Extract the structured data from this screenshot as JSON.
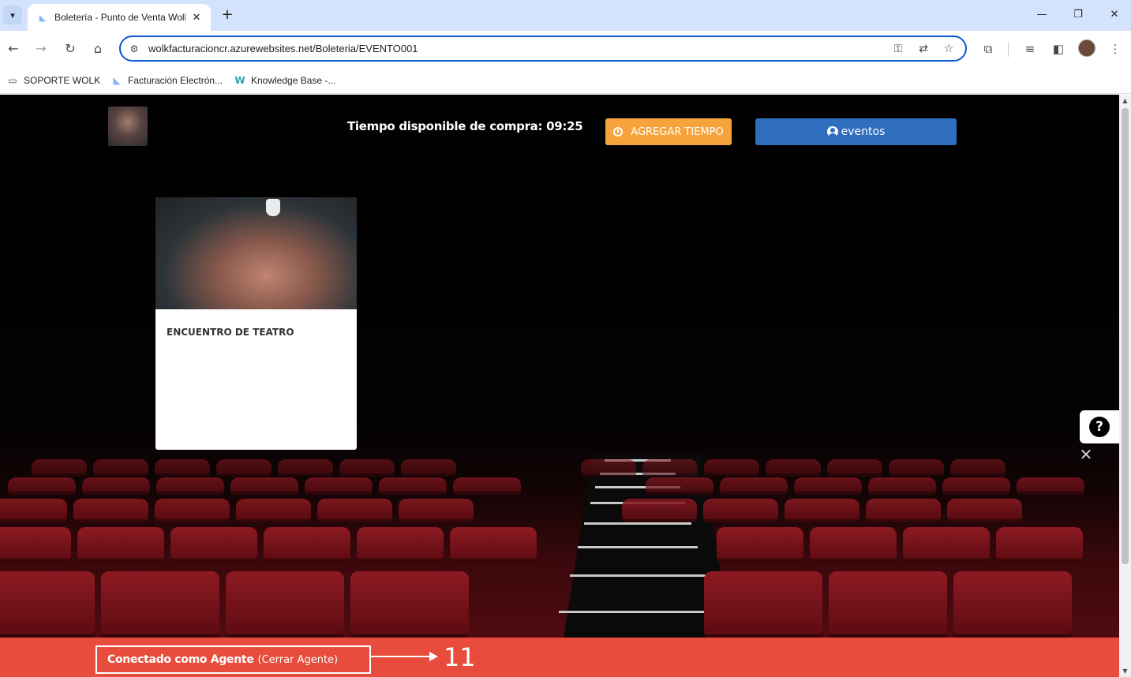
{
  "browser": {
    "tab_title": "Boletería - Punto de Venta Wolk",
    "tab_close": "✕",
    "new_tab": "+",
    "url": "wolkfacturacioncr.azurewebsites.net/Boleteria/EVENTO001",
    "window_controls": {
      "minimize": "—",
      "restore": "❐",
      "close": "✕"
    },
    "bookmarks": [
      {
        "label": "SOPORTE WOLK",
        "icon": "folder-icon"
      },
      {
        "label": "Facturación Electrón...",
        "icon": "favicon-icon"
      },
      {
        "label": "Knowledge Base -...",
        "icon": "wolk-logo-icon"
      }
    ]
  },
  "header": {
    "timer_label": "Tiempo disponible de compra:",
    "timer_value": "09:25",
    "add_time_button": "AGREGAR TIEMPO",
    "events_button": "eventos"
  },
  "events": [
    {
      "title": "ENCUENTRO DE TEATRO"
    }
  ],
  "help": {
    "symbol": "?",
    "close_symbol": "✕"
  },
  "agent_bar": {
    "connected_label": "Conectado como Agente",
    "logout_link": "(Cerrar Agente)",
    "annotation_number": "11"
  },
  "colors": {
    "accent_orange": "#f6a33c",
    "accent_blue": "#2f6dbd",
    "agent_bar_red": "#e74c3c",
    "omnibox_blue": "#0b57d0",
    "tabstrip_blue": "#d3e3fd"
  }
}
